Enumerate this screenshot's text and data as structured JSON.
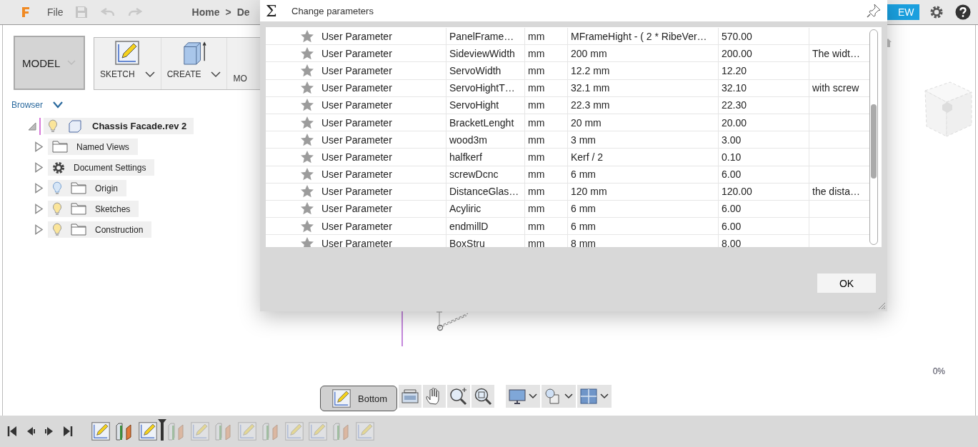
{
  "app_bar": {
    "file_menu": "File",
    "breadcrumb": [
      "Home",
      ">",
      "De"
    ],
    "view_button": "EW"
  },
  "toolbar": {
    "workspace": "MODEL",
    "groups": [
      {
        "label": "SKETCH",
        "kind": "sketch"
      },
      {
        "label": "CREATE",
        "kind": "create"
      },
      {
        "label": "MO",
        "kind": "cut"
      }
    ]
  },
  "browser": {
    "title": "Browser",
    "root": {
      "label": "Chassis Facade.rev 2",
      "expanded": true,
      "visible": true,
      "children": [
        {
          "label": "Named Views",
          "kind": "folder"
        },
        {
          "label": "Document Settings",
          "kind": "settings"
        },
        {
          "label": "Origin",
          "kind": "folder",
          "visible": false
        },
        {
          "label": "Sketches",
          "kind": "folder",
          "visible": true
        },
        {
          "label": "Construction",
          "kind": "folder",
          "visible": true
        }
      ]
    }
  },
  "dialog": {
    "title_glyph": "Σ",
    "title": "Change parameters",
    "rows": [
      {
        "type": "User Parameter",
        "name": "PanelFrame…",
        "unit": "mm",
        "expression": "MFrameHight - ( 2 * RibeVer…",
        "value": "570.00"
      },
      {
        "type": "User Parameter",
        "name": "SideviewWidth",
        "unit": "mm",
        "expression": "200 mm",
        "value": "200.00",
        "comment": "The widt…"
      },
      {
        "type": "User Parameter",
        "name": "ServoWidth",
        "unit": "mm",
        "expression": "12.2 mm",
        "value": "12.20"
      },
      {
        "type": "User Parameter",
        "name": "ServoHightT…",
        "unit": "mm",
        "expression": "32.1 mm",
        "value": "32.10",
        "comment": "with screw"
      },
      {
        "type": "User Parameter",
        "name": "ServoHight",
        "unit": "mm",
        "expression": "22.3 mm",
        "value": "22.30"
      },
      {
        "type": "User Parameter",
        "name": "BracketLenght",
        "unit": "mm",
        "expression": "20 mm",
        "value": "20.00"
      },
      {
        "type": "User Parameter",
        "name": "wood3m",
        "unit": "mm",
        "expression": "3 mm",
        "value": "3.00"
      },
      {
        "type": "User Parameter",
        "name": "halfkerf",
        "unit": "mm",
        "expression": "Kerf / 2",
        "value": "0.10"
      },
      {
        "type": "User Parameter",
        "name": "screwDcnc",
        "unit": "mm",
        "expression": "6 mm",
        "value": "6.00"
      },
      {
        "type": "User Parameter",
        "name": "DistanceGlas…",
        "unit": "mm",
        "expression": "120 mm",
        "value": "120.00",
        "comment": "the dista…"
      },
      {
        "type": "User Parameter",
        "name": "Acyliric",
        "unit": "mm",
        "expression": "6 mm",
        "value": "6.00"
      },
      {
        "type": "User Parameter",
        "name": "endmillD",
        "unit": "mm",
        "expression": "6 mm",
        "value": "6.00"
      },
      {
        "type": "User Parameter",
        "name": "BoxStru",
        "unit": "mm",
        "expression": "8 mm",
        "value": "8.00"
      }
    ],
    "ok_button": "OK"
  },
  "viewport": {
    "progress": "0%",
    "tooltip": "Bottom"
  },
  "timeline": {
    "items": [
      {
        "kind": "sketch",
        "faded": false
      },
      {
        "kind": "extrude",
        "faded": false
      },
      {
        "kind": "sketch",
        "faded": false
      },
      {
        "kind": "extrude",
        "faded": true
      },
      {
        "kind": "sketch",
        "faded": true
      },
      {
        "kind": "extrude",
        "faded": true
      },
      {
        "kind": "sketch",
        "faded": true
      },
      {
        "kind": "extrude",
        "faded": true
      },
      {
        "kind": "sketch",
        "faded": true
      },
      {
        "kind": "sketch",
        "faded": true
      },
      {
        "kind": "extrude",
        "faded": true
      },
      {
        "kind": "sketch",
        "faded": true
      }
    ]
  }
}
